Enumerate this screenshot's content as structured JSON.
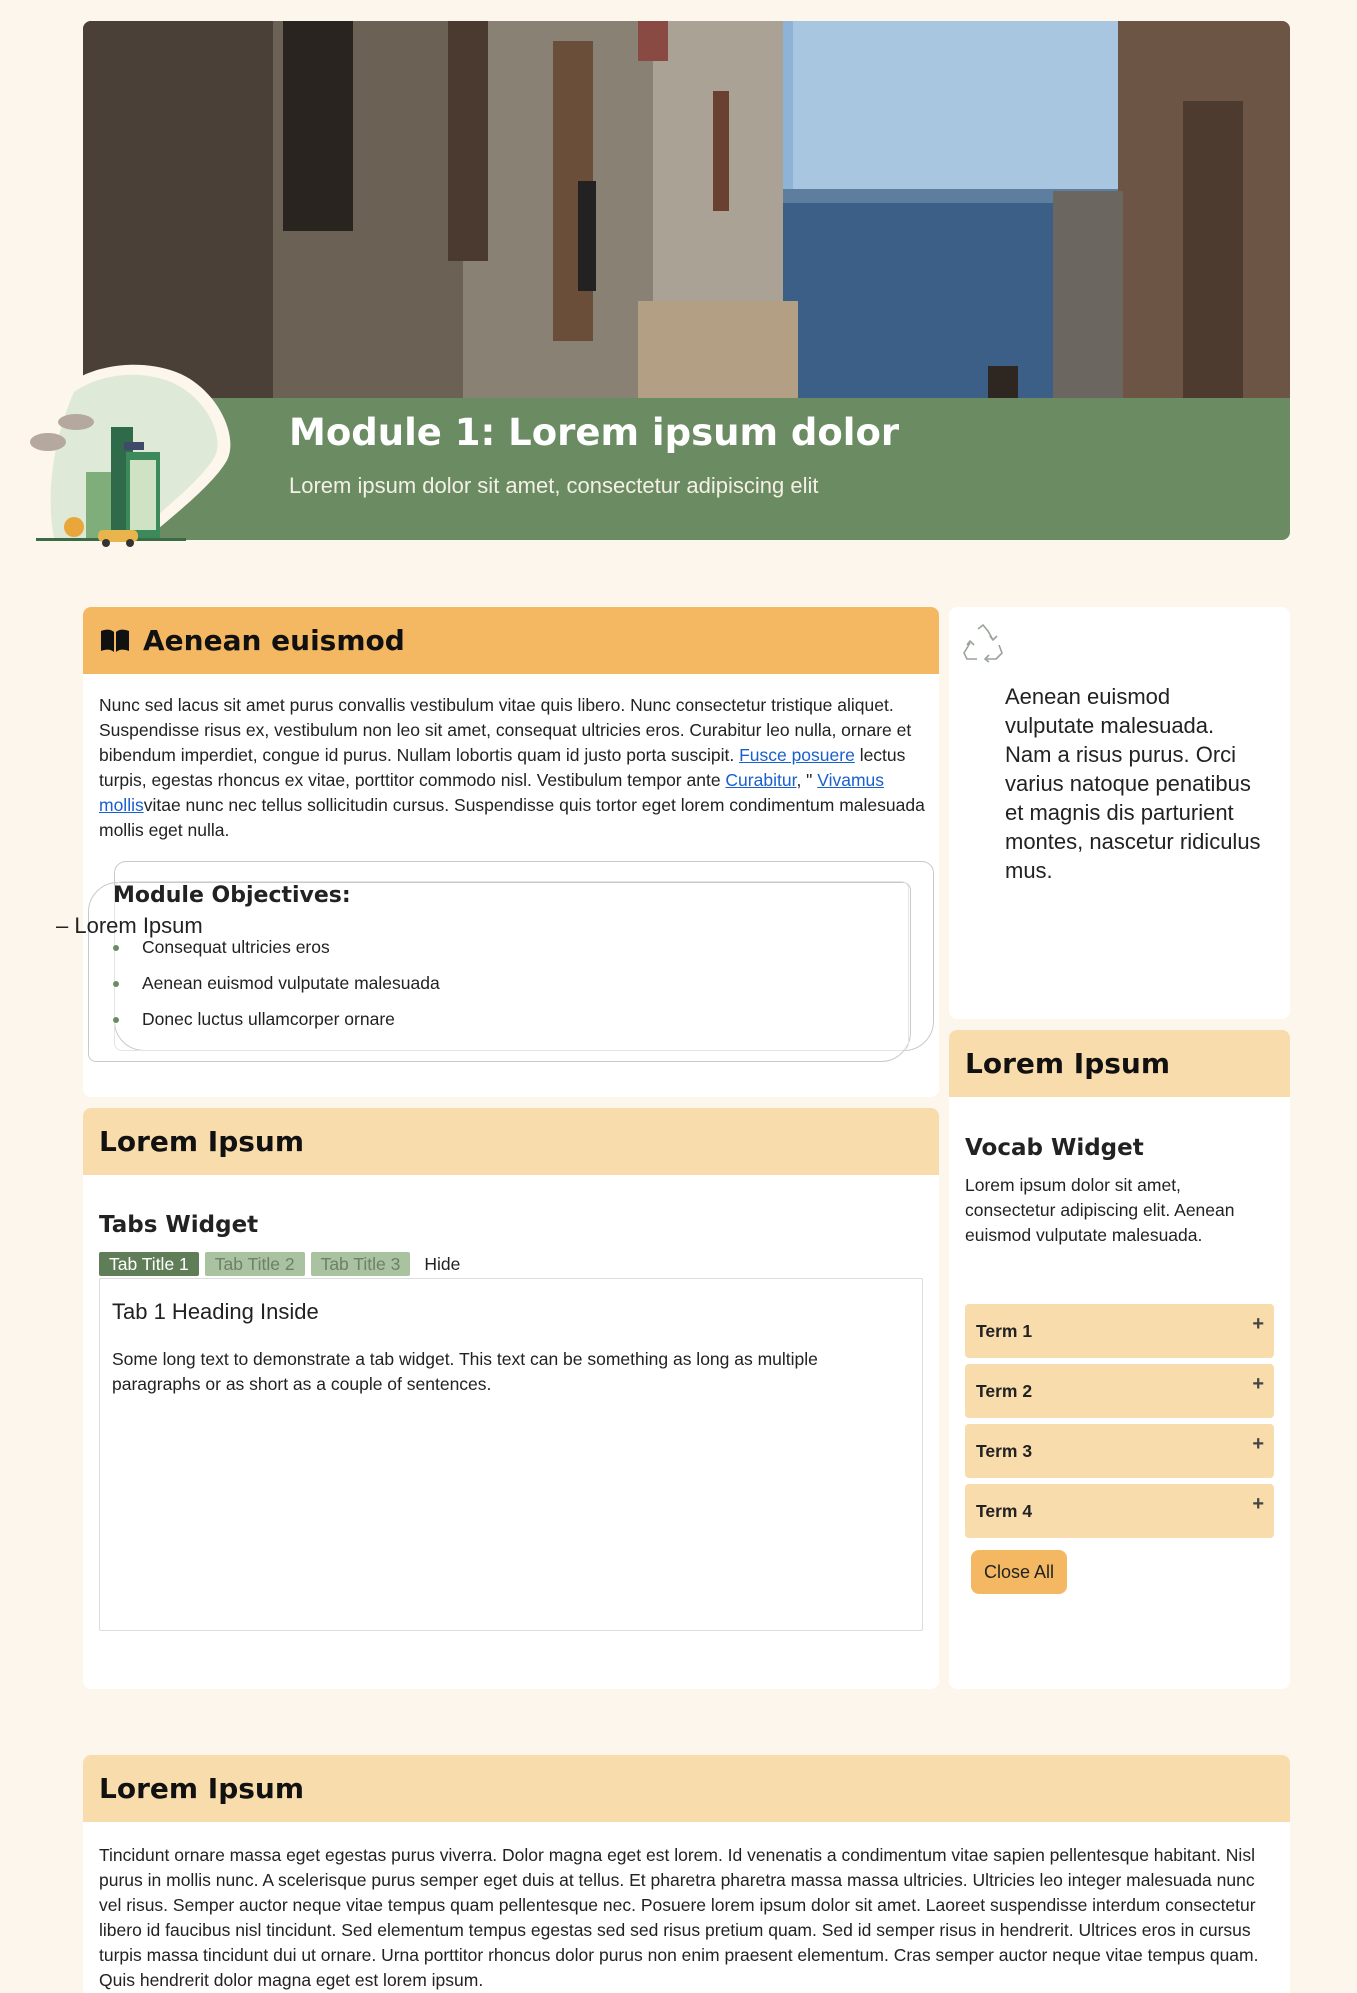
{
  "hero": {
    "title": "Module 1: Lorem ipsum dolor",
    "subtitle": "Lorem ipsum dolor sit amet, consectetur adipiscing elit"
  },
  "intro_card": {
    "heading": "Aenean euismod",
    "icon": "open-book-icon",
    "paragraph_part1": "Nunc sed lacus sit amet purus convallis vestibulum vitae quis libero. Nunc consectetur tristique aliquet. Suspendisse risus ex, vestibulum non leo sit amet, consequat ultricies eros. Curabitur leo nulla, ornare et bibendum imperdiet, congue id purus. Nullam lobortis quam id justo porta suscipit. ",
    "link1": "Fusce posuere",
    "paragraph_part2": " lectus turpis, egestas rhoncus ex vitae, porttitor commodo nisl. Vestibulum tempor ante ",
    "link2": "Curabitur",
    "paragraph_part3": ", \" ",
    "link3": "Vivamus mollis",
    "paragraph_part4": "vitae nunc nec tellus sollicitudin cursus. Suspendisse quis tortor eget lorem condimentum malesuada mollis eget nulla.",
    "objectives_title": "Module Objectives:",
    "objectives": [
      "Consequat ultricies eros",
      "Aenean euismod vulputate malesuada",
      "Donec luctus ullamcorper ornare"
    ]
  },
  "quote_card": {
    "icon": "recycle-icon",
    "quote": "Aenean euismod vulputate malesuada. Nam a risus purus. Orci varius natoque penatibus et magnis dis parturient montes, nascetur ridiculus mus.",
    "author": "– Lorem Ipsum"
  },
  "vocab_card": {
    "heading": "Lorem Ipsum",
    "title": "Vocab Widget",
    "description": "Lorem ipsum dolor sit amet, consectetur adipiscing elit. Aenean euismod vulputate malesuada.",
    "terms": [
      "Term 1",
      "Term 2",
      "Term 3",
      "Term 4"
    ],
    "plus": "+",
    "close_all": "Close All"
  },
  "tabs_card": {
    "heading": "Lorem Ipsum",
    "title": "Tabs Widget",
    "tabs": [
      "Tab Title 1",
      "Tab Title 2",
      "Tab Title 3"
    ],
    "hide": "Hide",
    "panel_heading": "Tab 1 Heading Inside",
    "panel_text": "Some long text to demonstrate a tab widget. This text can be something as long as multiple paragraphs or as short as a couple of sentences."
  },
  "bottom_card": {
    "heading": "Lorem Ipsum",
    "text": "Tincidunt ornare massa eget egestas purus viverra. Dolor magna eget est lorem. Id venenatis a condimentum vitae sapien pellentesque habitant. Nisl purus in mollis nunc. A scelerisque purus semper eget duis at tellus. Et pharetra pharetra massa massa ultricies. Ultricies leo integer malesuada nunc vel risus. Semper auctor neque vitae tempus quam pellentesque nec. Posuere lorem ipsum dolor sit amet. Laoreet suspendisse interdum consectetur libero id faucibus nisl tincidunt. Sed elementum tempus egestas sed sed risus pretium quam. Sed id semper risus in hendrerit. Ultrices eros in cursus turpis massa tincidunt dui ut ornare. Urna porttitor rhoncus dolor purus non enim praesent elementum. Cras semper auctor neque vitae tempus quam. Quis hendrerit dolor magna eget est lorem ipsum."
  },
  "colors": {
    "page_bg": "#fdf6ec",
    "banner_green": "#6b8c62",
    "header_orange": "#f4b862",
    "header_peach": "#f9dcac",
    "link_blue": "#1a5fcf"
  }
}
